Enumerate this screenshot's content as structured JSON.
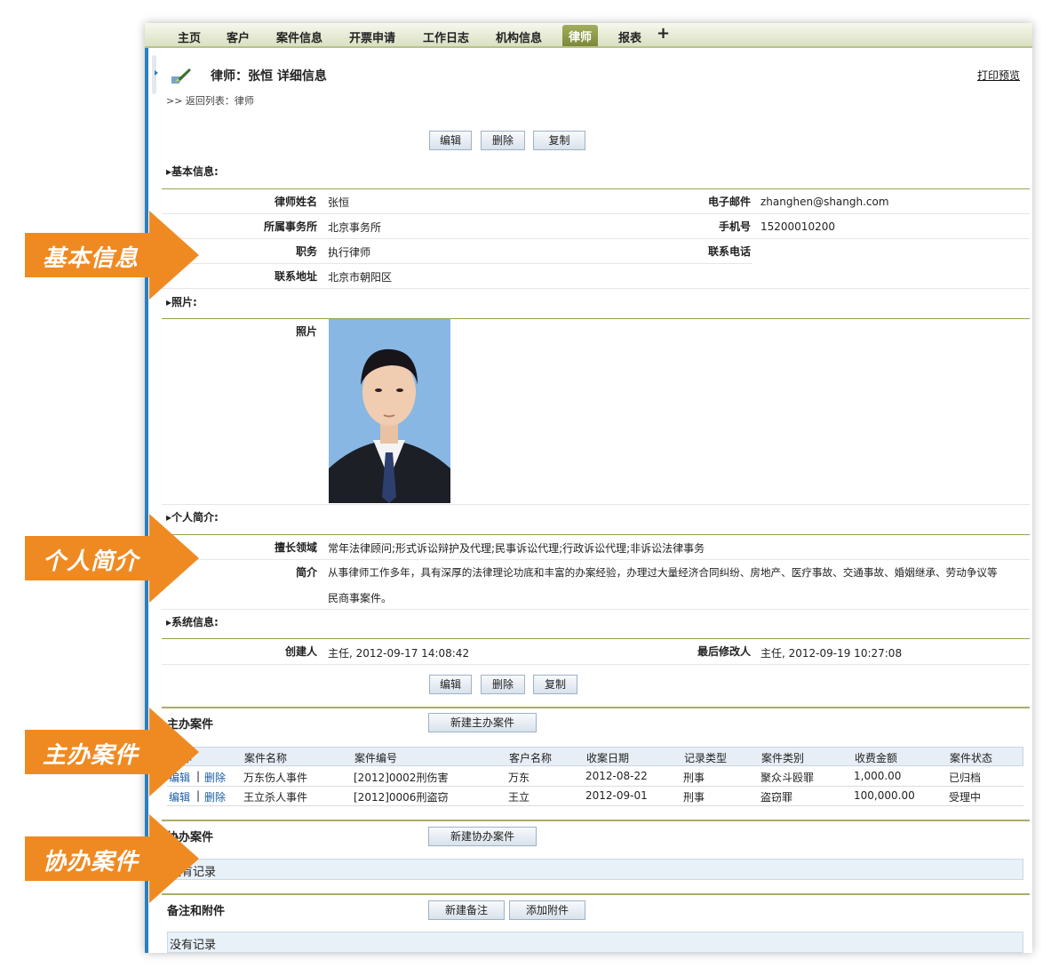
{
  "nav": {
    "tabs": [
      "主页",
      "客户",
      "案件信息",
      "开票申请",
      "工作日志",
      "机构信息",
      "律师",
      "报表"
    ],
    "active_tab": "律师",
    "plus_label": "+"
  },
  "header": {
    "title": "律师：张恒 详细信息",
    "print_link": "打印预览",
    "breadcrumb": ">> 返回列表：律师"
  },
  "actions": {
    "edit": "编辑",
    "delete": "删除",
    "copy": "复制"
  },
  "basic": {
    "heading": "▸基本信息:",
    "name_label": "律师姓名",
    "name": "张恒",
    "email_label": "电子邮件",
    "email": "zhanghen@shangh.com",
    "firm_label": "所属事务所",
    "firm": "北京事务所",
    "mobile_label": "手机号",
    "mobile": "15200010200",
    "position_label": "职务",
    "position": "执行律师",
    "phone_label": "联系电话",
    "phone": "",
    "address_label": "联系地址",
    "address": "北京市朝阳区"
  },
  "photo_section": {
    "heading": "▸照片:",
    "label": "照片"
  },
  "profile": {
    "heading": "▸个人简介:",
    "expertise_label": "擅长领域",
    "expertise": "常年法律顾问;形式诉讼辩护及代理;民事诉讼代理;行政诉讼代理;非诉讼法律事务",
    "intro_label": "简介",
    "intro_line1": "从事律师工作多年，具有深厚的法律理论功底和丰富的办案经验，办理过大量经济合同纠纷、房地产、医疗事故、交通事故、婚姻继承、劳动争议等",
    "intro_line2": "民商事案件。"
  },
  "system": {
    "heading": "▸系统信息:",
    "creator_label": "创建人",
    "creator": "主任, 2012-09-17 14:08:42",
    "modifier_label": "最后修改人",
    "modifier": "主任, 2012-09-19 10:27:08"
  },
  "main_cases": {
    "title": "主办案件",
    "new_button": "新建主办案件",
    "columns": [
      "操作",
      "案件名称",
      "案件编号",
      "客户名称",
      "收案日期",
      "记录类型",
      "案件类别",
      "收费金额",
      "案件状态"
    ],
    "rows": [
      {
        "edit": "编辑",
        "sep": "|",
        "delete": "删除",
        "name": "万东伤人事件",
        "code": "[2012]0002刑伤害",
        "client": "万东",
        "date": "2012-08-22",
        "type": "刑事",
        "category": "聚众斗殴罪",
        "fee": "1,000.00",
        "status": "已归档"
      },
      {
        "edit": "编辑",
        "sep": "|",
        "delete": "删除",
        "name": "王立杀人事件",
        "code": "[2012]0006刑盗窃",
        "client": "王立",
        "date": "2012-09-01",
        "type": "刑事",
        "category": "盗窃罪",
        "fee": "100,000.00",
        "status": "受理中"
      }
    ]
  },
  "assist_cases": {
    "title": "协办案件",
    "new_button": "新建协办案件",
    "empty": "没有记录"
  },
  "notes": {
    "title": "备注和附件",
    "new_note": "新建备注",
    "add_attachment": "添加附件",
    "empty": "没有记录"
  },
  "callouts": {
    "basic": "基本信息",
    "profile": "个人简介",
    "main": "主办案件",
    "assist": "协办案件"
  },
  "colors": {
    "nav_active": "#8a9640",
    "callout": "#f08a24",
    "link": "#1a5ea8",
    "rule": "#98a050"
  }
}
